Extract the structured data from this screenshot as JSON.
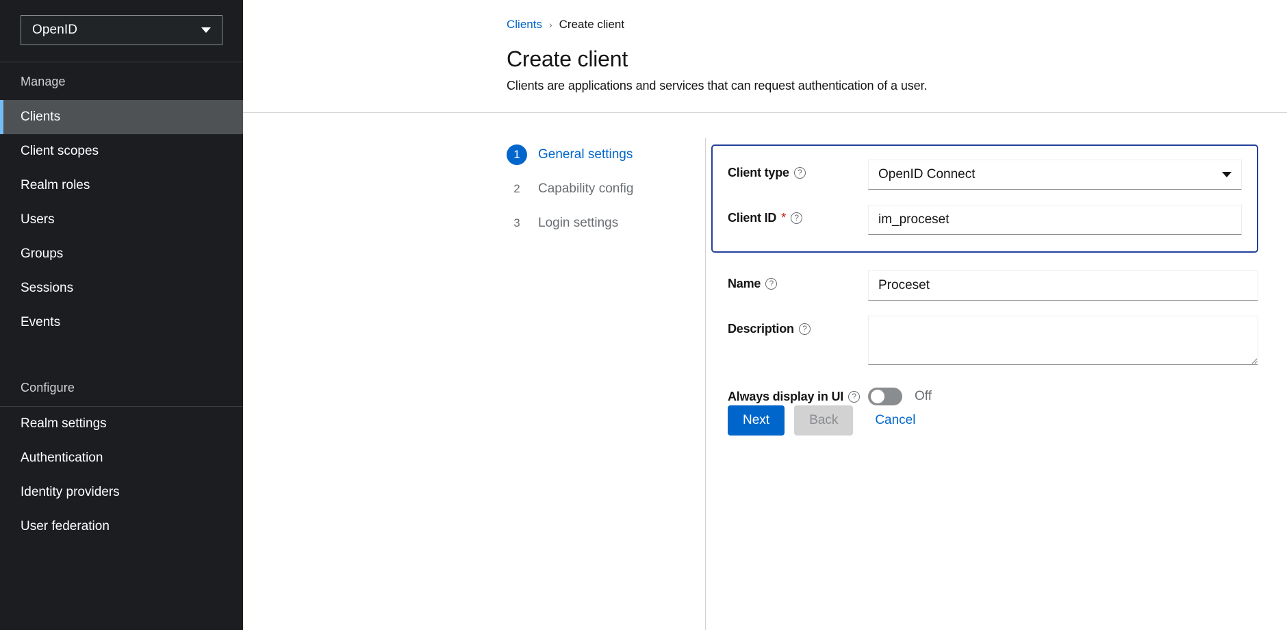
{
  "sidebar": {
    "realm_selector": {
      "value": "OpenID",
      "caret_icon": "chevron-down-icon"
    },
    "sections": [
      {
        "title": "Manage",
        "items": [
          {
            "label": "Clients",
            "active": true
          },
          {
            "label": "Client scopes",
            "active": false
          },
          {
            "label": "Realm roles",
            "active": false
          },
          {
            "label": "Users",
            "active": false
          },
          {
            "label": "Groups",
            "active": false
          },
          {
            "label": "Sessions",
            "active": false
          },
          {
            "label": "Events",
            "active": false
          }
        ]
      },
      {
        "title": "Configure",
        "items": [
          {
            "label": "Realm settings",
            "active": false
          },
          {
            "label": "Authentication",
            "active": false
          },
          {
            "label": "Identity providers",
            "active": false
          },
          {
            "label": "User federation",
            "active": false
          }
        ]
      }
    ]
  },
  "breadcrumb": {
    "link": "Clients",
    "separator": "›",
    "current": "Create client"
  },
  "header": {
    "title": "Create client",
    "subtitle": "Clients are applications and services that can request authentication of a user."
  },
  "wizard": {
    "steps": [
      {
        "number": "1",
        "label": "General settings",
        "state": "current"
      },
      {
        "number": "2",
        "label": "Capability config",
        "state": "idle"
      },
      {
        "number": "3",
        "label": "Login settings",
        "state": "idle"
      }
    ]
  },
  "form": {
    "client_type": {
      "label": "Client type",
      "value": "OpenID Connect",
      "help_icon": "question-circle-icon",
      "caret_icon": "caret-down-icon"
    },
    "client_id": {
      "label": "Client ID",
      "required_marker": "*",
      "value": "im_proceset",
      "placeholder": "",
      "help_icon": "question-circle-icon"
    },
    "name": {
      "label": "Name",
      "value": "Proceset",
      "placeholder": "",
      "help_icon": "question-circle-icon"
    },
    "description": {
      "label": "Description",
      "value": "",
      "placeholder": "",
      "help_icon": "question-circle-icon"
    },
    "always_display": {
      "label": "Always display in UI",
      "state_text": "Off",
      "enabled": false,
      "help_icon": "question-circle-icon"
    }
  },
  "actions": {
    "next": "Next",
    "back": "Back",
    "cancel": "Cancel"
  },
  "colors": {
    "accent_blue": "#0066cc",
    "highlight_border": "#20409a",
    "sidebar_bg": "#1b1d21",
    "active_item_bg": "#4f5255",
    "active_item_accent": "#73bcf7",
    "required_red": "#c9190b"
  }
}
